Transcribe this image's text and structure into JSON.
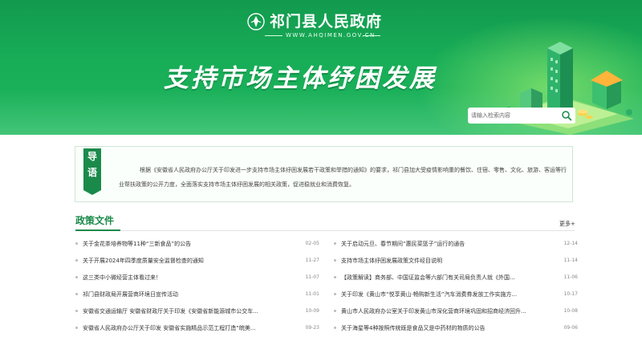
{
  "header": {
    "site_title": "祁门县人民政府",
    "site_url": "WWW.AHQIMEN.GOV.CN",
    "slogan": "支持市场主体纾困发展"
  },
  "search": {
    "placeholder": "请输入检索内容"
  },
  "intro": {
    "tag_char_1": "导",
    "tag_char_2": "语",
    "text": "根据《安徽省人民政府办公厅关于印发进一步支持市场主体纾困发展若干政策和举措的通知》的要求，祁门县加大受疫情影响重的餐饮、住宿、零售、文化、旅游、客运等行业帮扶政策的公开力度，全面落实支持市场主体纾困发展的相关政策，促进稳就业和消费恢复。"
  },
  "section": {
    "title": "政策文件",
    "more_label": "更多+"
  },
  "news_left": [
    {
      "title": "关于金花茶培养物等11种“三新食品”的公告",
      "date": "02-05"
    },
    {
      "title": "关于开展2024年四季度质量安全监督检查的通知",
      "date": "11-27"
    },
    {
      "title": "这三类中小微经营主体看过来！",
      "date": "11-07"
    },
    {
      "title": "祁门县财政局开展营商环境日宣传活动",
      "date": "11-01"
    },
    {
      "title": "安徽省交通运输厅 安徽省财政厅关于印发《安徽省新能源城市公交车...",
      "date": "10-09"
    },
    {
      "title": "安徽省人民政府办公厅关于印发 安徽省实施精品示范工程打造“皖美...",
      "date": "09-23"
    }
  ],
  "news_right": [
    {
      "title": "关于启动元旦、春节期间“惠民菜篮子”运行的通告",
      "date": "12-14"
    },
    {
      "title": "支持市场主体纾困发展政策文件经目说明",
      "date": "11-14"
    },
    {
      "title": "【政策解读】商务部、中国证监会等六部门有关司局负责人就《外国...",
      "date": "11-06"
    },
    {
      "title": "关于印发《黄山市“悦享黄山·畅购新生活”汽车消费券发放工作实施方...",
      "date": "10-17"
    },
    {
      "title": "黄山市人民政府办公室关于印发黄山市深化营商环境巩固和招商经济回升...",
      "date": "10-08"
    },
    {
      "title": "关于海星等4种按照传统既是食品又是中药材的物质的公告",
      "date": "09-06"
    }
  ],
  "colors": {
    "brand_green": "#1a8a4a",
    "banner_green": "#18ad57"
  },
  "icons": {
    "logo": "emblem-logo-icon",
    "search": "search-icon"
  }
}
